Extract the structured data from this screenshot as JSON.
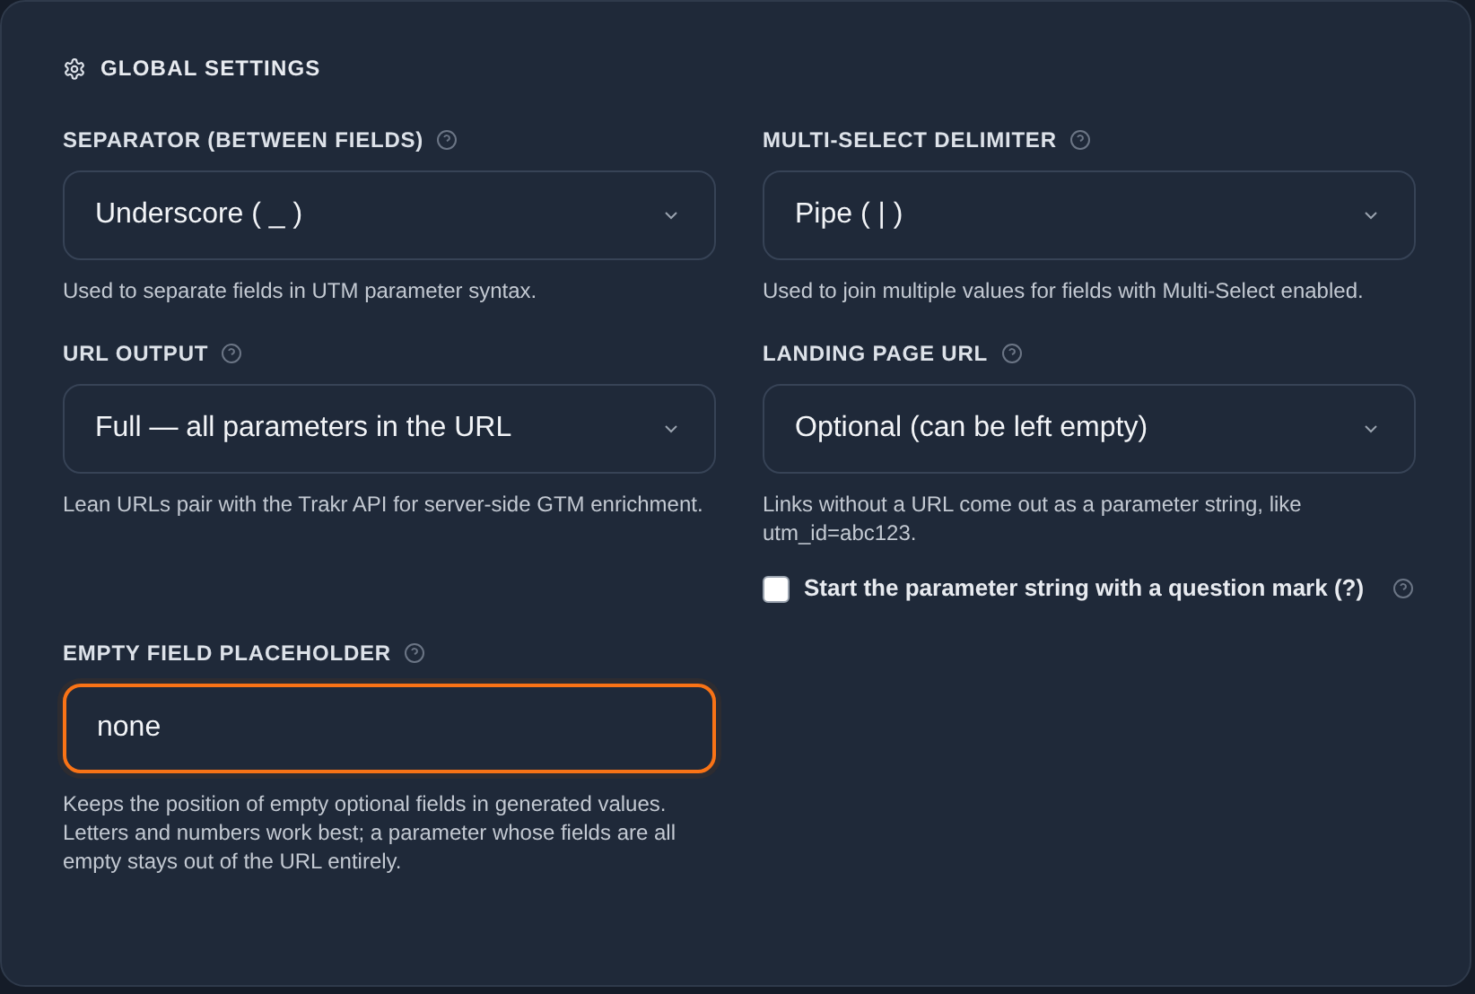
{
  "title": "GLOBAL SETTINGS",
  "fields": [
    {
      "label": "SEPARATOR (BETWEEN FIELDS)",
      "kind": "select",
      "value": "Underscore ( _ )",
      "help": "Used to separate fields in UTM parameter syntax.",
      "focused": false
    },
    {
      "label": "MULTI-SELECT DELIMITER",
      "kind": "select",
      "value": "Pipe ( | )",
      "help": "Used to join multiple values for fields with Multi-Select enabled.",
      "focused": false
    },
    {
      "label": "URL OUTPUT",
      "kind": "select",
      "value": "Full — all parameters in the URL",
      "help": "Lean URLs pair with the Trakr API for server-side GTM enrichment.",
      "focused": false
    },
    {
      "label": "LANDING PAGE URL",
      "kind": "select",
      "value": "Optional (can be left empty)",
      "help": "Links without a URL come out as a parameter string, like utm_id=abc123.",
      "focused": false,
      "checkbox": {
        "label": "Start the parameter string with a question mark (?)",
        "checked": false
      }
    },
    {
      "label": "EMPTY FIELD PLACEHOLDER",
      "kind": "input",
      "value": "none",
      "help": "Keeps the position of empty optional fields in generated values. Letters and numbers work best; a parameter whose fields are all empty stays out of the URL entirely.",
      "focused": true
    }
  ]
}
